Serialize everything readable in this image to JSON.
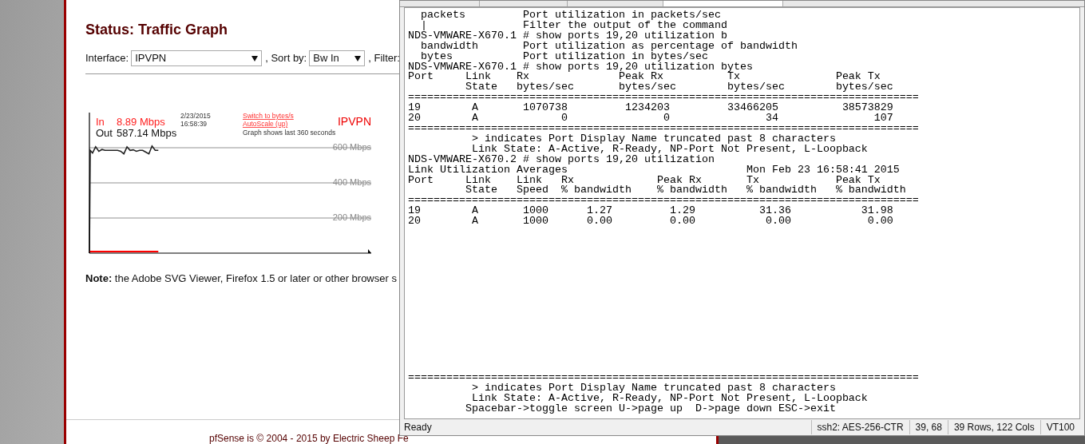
{
  "page": {
    "title": "Status: Traffic Graph",
    "filters": [
      {
        "label": "Interface:",
        "value": "IPVPN"
      },
      {
        "label": ", Sort by:",
        "value": "Bw In"
      }
    ],
    "filter_cut_label": ", Filter:",
    "graph": {
      "in_label": "In",
      "in_value": "8.89 Mbps",
      "out_label": "Out",
      "out_value": "587.14 Mbps",
      "date": "2/23/2015",
      "time": "16:58:39",
      "links": [
        "Switch to bytes/s",
        "AutoScale (up)"
      ],
      "caption": "Graph shows last 360 seconds",
      "interface_name": "IPVPN",
      "grid_labels": [
        "600 Mbps",
        "400 Mbps",
        "200 Mbps"
      ]
    },
    "note": "**Note:** the Adobe SVG Viewer, Firefox 1.5 or later or other browser s",
    "footer": "pfSense is © 2004 - 2015 by Electric Sheep Fe"
  },
  "terminal": {
    "output": [
      "  packets         Port utilization in packets/sec",
      "  |               Filter the output of the command",
      "NDS-VMWARE-X670.1 # show ports 19,20 utilization b",
      "  bandwidth       Port utilization as percentage of bandwidth",
      "  bytes           Port utilization in bytes/sec",
      "NDS-VMWARE-X670.1 # show ports 19,20 utilization bytes",
      "Port     Link    Rx              Peak Rx          Tx               Peak Tx",
      "         State   bytes/sec       bytes/sec        bytes/sec        bytes/sec",
      "================================================================================",
      "19        A       1070738         1234203         33466205          38573829",
      "20        A             0               0               34               107",
      "================================================================================",
      "          > indicates Port Display Name truncated past 8 characters",
      "          Link State: A-Active, R-Ready, NP-Port Not Present, L-Loopback",
      "NDS-VMWARE-X670.2 # show ports 19,20 utilization",
      "Link Utilization Averages                            Mon Feb 23 16:58:41 2015",
      "Port     Link    Link   Rx             Peak Rx       Tx            Peak Tx",
      "         State   Speed  % bandwidth    % bandwidth   % bandwidth   % bandwidth",
      "================================================================================",
      "19        A       1000      1.27         1.29          31.36           31.98",
      "20        A       1000      0.00         0.00           0.00            0.00"
    ],
    "bottom_output": [
      "================================================================================",
      "          > indicates Port Display Name truncated past 8 characters",
      "          Link State: A-Active, R-Ready, NP-Port Not Present, L-Loopback",
      "         Spacebar->toggle screen U->page up  D->page down ESC->exit"
    ],
    "status_bar": [
      "Ready",
      "ssh2: AES-256-CTR",
      "39,  68",
      "39 Rows, 122 Cols",
      "VT100"
    ]
  }
}
